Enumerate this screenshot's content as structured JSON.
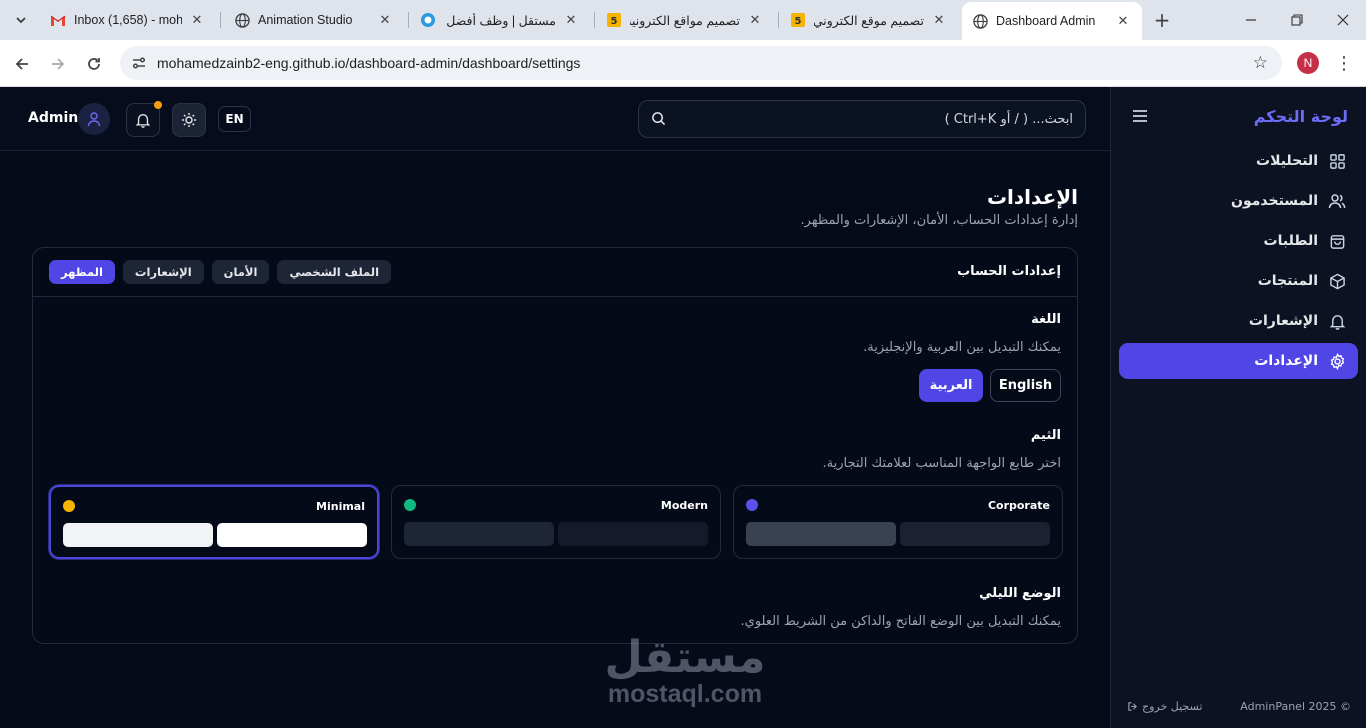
{
  "browser": {
    "tabs": [
      {
        "title": "Inbox (1,658) - moha",
        "icon": "gmail-icon"
      },
      {
        "title": "Animation Studio",
        "icon": "globe-icon"
      },
      {
        "title": "مستقل | وظف أفضل ا",
        "icon": "mostaql-icon"
      },
      {
        "title": "تصميم مواقع الكترونيه",
        "icon": "khamsat-icon"
      },
      {
        "title": "تصميم موقع الكتروني",
        "icon": "khamsat-icon"
      },
      {
        "title": "Dashboard Admin",
        "icon": "globe-icon"
      }
    ],
    "url": "mohamedzainb2-eng.github.io/dashboard-admin/dashboard/settings",
    "profile_initial": "N"
  },
  "sidebar": {
    "brand": "لوحة التحكم",
    "items": [
      {
        "label": "التحليلات",
        "icon": "grid-icon"
      },
      {
        "label": "المستخدمون",
        "icon": "users-icon"
      },
      {
        "label": "الطلبات",
        "icon": "shopping-bag-icon"
      },
      {
        "label": "المنتجات",
        "icon": "box-icon"
      },
      {
        "label": "الإشعارات",
        "icon": "bell-icon"
      },
      {
        "label": "الإعدادات",
        "icon": "gear-icon"
      }
    ],
    "footer_copyright": "AdminPanel 2025 ©",
    "logout_label": "تسجيل خروج"
  },
  "topbar": {
    "admin_name": "Admin",
    "lang_toggle": "EN",
    "search_placeholder": "ابحث... ( / أو Ctrl+K )"
  },
  "page": {
    "title": "الإعدادات",
    "subtitle": "إدارة إعدادات الحساب، الأمان، الإشعارات والمظهر."
  },
  "card": {
    "title": "إعدادات الحساب",
    "tabs": [
      "المظهر",
      "الإشعارات",
      "الأمان",
      "الملف الشخصي"
    ],
    "active_tab": "المظهر",
    "language": {
      "title": "اللغة",
      "desc": "يمكنك التبديل بين العربية والإنجليزية.",
      "arabic_label": "العربية",
      "english_label": "English"
    },
    "theme": {
      "title": "الثيم",
      "desc": "اختر طابع الواجهة المناسب لعلامتك التجارية.",
      "options": [
        {
          "name": "Minimal",
          "dot": "#f5b400",
          "bars": [
            "#f1f3f7",
            "#ffffff"
          ],
          "selected": true
        },
        {
          "name": "Modern",
          "dot": "#10b981",
          "bars": [
            "#1e2536",
            "#141a29"
          ],
          "selected": false
        },
        {
          "name": "Corporate",
          "dot": "#5b50f0",
          "bars": [
            "#3a4252",
            "#1b2130"
          ],
          "selected": false
        }
      ]
    },
    "night": {
      "title": "الوضع الليلي",
      "desc": "يمكنك التبديل بين الوضع الفاتح والداكن من الشريط العلوي."
    }
  },
  "watermark": {
    "ar": "مستقل",
    "en": "mostaql.com"
  },
  "colors": {
    "accent": "#5046e5",
    "brand": "#6d6cf6",
    "background": "#060b1a"
  }
}
